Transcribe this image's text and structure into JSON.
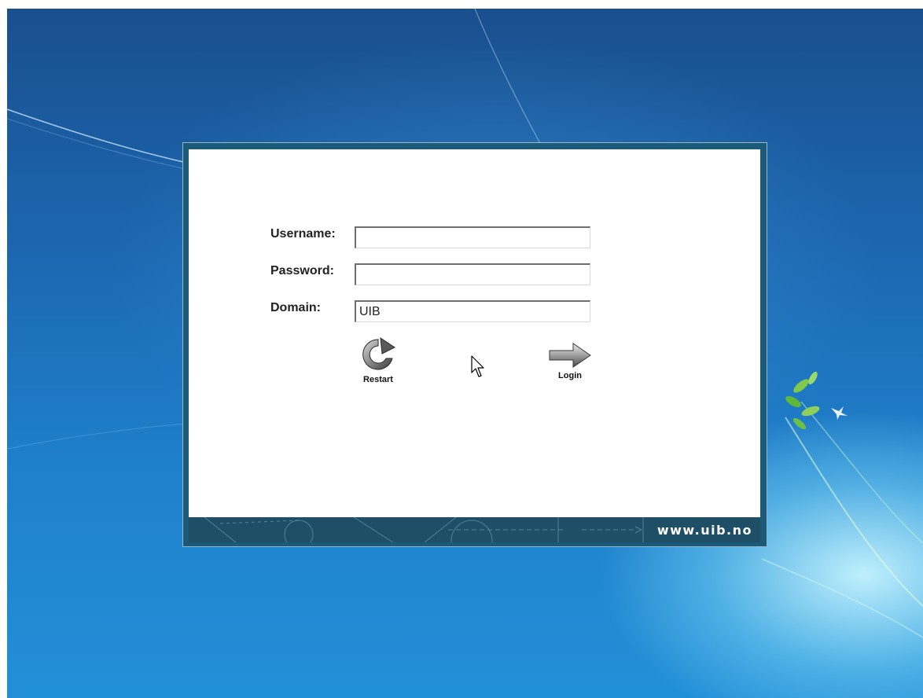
{
  "login_dialog": {
    "username_label": "Username:",
    "username_value": "",
    "password_label": "Password:",
    "password_value": "",
    "domain_label": "Domain:",
    "domain_value": "UIB",
    "restart_label": "Restart",
    "login_label": "Login",
    "footer_url": "www.uib.no"
  },
  "icons": {
    "restart": "restart-icon",
    "login": "arrow-right-icon",
    "cursor": "mouse-pointer-icon"
  },
  "colors": {
    "desktop_blue": "#1c67b0",
    "dialog_frame": "#1b5a78",
    "footer": "#1f4f66"
  }
}
